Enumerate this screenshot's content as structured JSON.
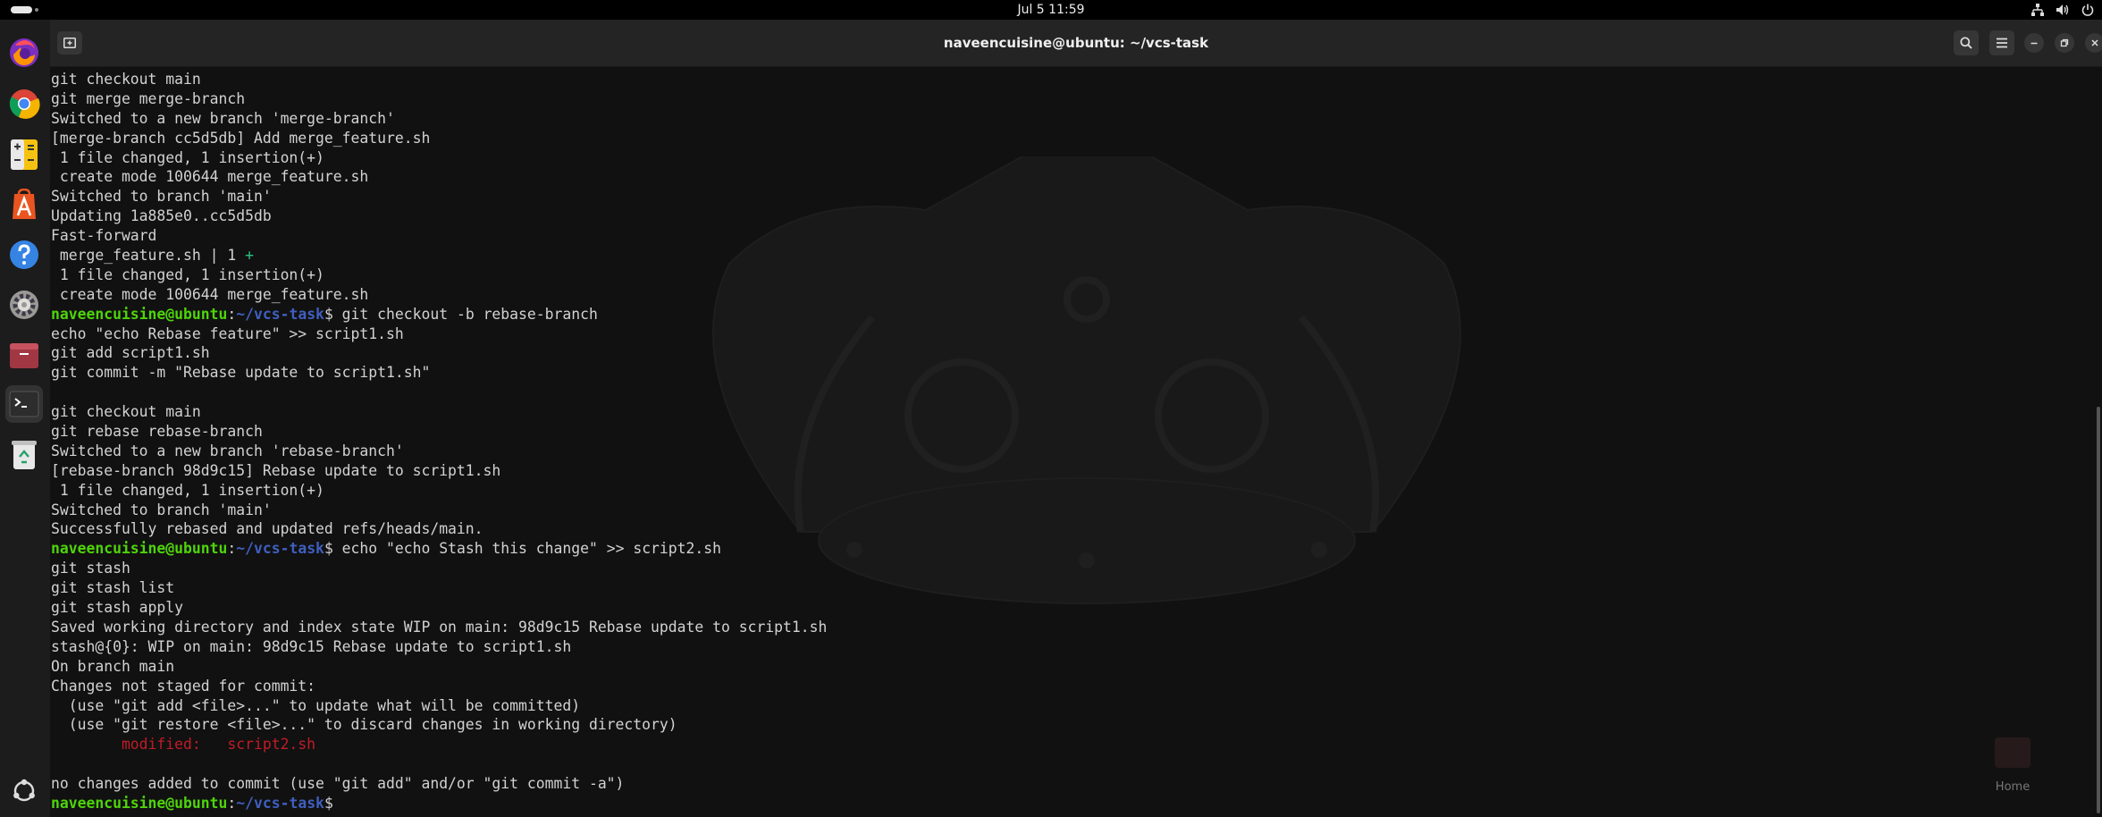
{
  "topbar": {
    "clock": "Jul 5  11:59",
    "tray_icons": [
      "network-icon",
      "volume-icon",
      "power-icon"
    ]
  },
  "dock": {
    "items": [
      "firefox-icon",
      "chrome-icon",
      "calculator-icon",
      "app-center-icon",
      "help-icon",
      "settings-icon",
      "files-icon",
      "terminal-icon",
      "trash-icon"
    ],
    "show_apps": "show-apps-icon"
  },
  "window": {
    "title": "naveencuisine@ubuntu: ~/vcs-task"
  },
  "prompt": {
    "user": "naveencuisine@ubuntu",
    "path": "~/vcs-task",
    "sep": ":",
    "dollar": "$"
  },
  "terminal": {
    "lines": [
      {
        "t": "text",
        "text": "git checkout main"
      },
      {
        "t": "text",
        "text": "git merge merge-branch"
      },
      {
        "t": "text",
        "text": "Switched to a new branch 'merge-branch'"
      },
      {
        "t": "text",
        "text": "[merge-branch cc5d5db] Add merge_feature.sh"
      },
      {
        "t": "text",
        "text": " 1 file changed, 1 insertion(+)"
      },
      {
        "t": "text",
        "text": " create mode 100644 merge_feature.sh"
      },
      {
        "t": "text",
        "text": "Switched to branch 'main'"
      },
      {
        "t": "text",
        "text": "Updating 1a885e0..cc5d5db"
      },
      {
        "t": "text",
        "text": "Fast-forward"
      },
      {
        "t": "diffstat",
        "text": " merge_feature.sh | 1 ",
        "plus": "+"
      },
      {
        "t": "text",
        "text": " 1 file changed, 1 insertion(+)"
      },
      {
        "t": "text",
        "text": " create mode 100644 merge_feature.sh"
      },
      {
        "t": "prompt",
        "cmd": " git checkout -b rebase-branch"
      },
      {
        "t": "text",
        "text": "echo \"echo Rebase feature\" >> script1.sh"
      },
      {
        "t": "text",
        "text": "git add script1.sh"
      },
      {
        "t": "text",
        "text": "git commit -m \"Rebase update to script1.sh\""
      },
      {
        "t": "text",
        "text": ""
      },
      {
        "t": "text",
        "text": "git checkout main"
      },
      {
        "t": "text",
        "text": "git rebase rebase-branch"
      },
      {
        "t": "text",
        "text": "Switched to a new branch 'rebase-branch'"
      },
      {
        "t": "text",
        "text": "[rebase-branch 98d9c15] Rebase update to script1.sh"
      },
      {
        "t": "text",
        "text": " 1 file changed, 1 insertion(+)"
      },
      {
        "t": "text",
        "text": "Switched to branch 'main'"
      },
      {
        "t": "text",
        "text": "Successfully rebased and updated refs/heads/main."
      },
      {
        "t": "prompt",
        "cmd": " echo \"echo Stash this change\" >> script2.sh"
      },
      {
        "t": "text",
        "text": "git stash"
      },
      {
        "t": "text",
        "text": "git stash list"
      },
      {
        "t": "text",
        "text": "git stash apply"
      },
      {
        "t": "text",
        "text": "Saved working directory and index state WIP on main: 98d9c15 Rebase update to script1.sh"
      },
      {
        "t": "text",
        "text": "stash@{0}: WIP on main: 98d9c15 Rebase update to script1.sh"
      },
      {
        "t": "text",
        "text": "On branch main"
      },
      {
        "t": "text",
        "text": "Changes not staged for commit:"
      },
      {
        "t": "text",
        "text": "  (use \"git add <file>...\" to update what will be committed)"
      },
      {
        "t": "text",
        "text": "  (use \"git restore <file>...\" to discard changes in working directory)"
      },
      {
        "t": "modified",
        "text": "\tmodified:   script2.sh"
      },
      {
        "t": "text",
        "text": ""
      },
      {
        "t": "text",
        "text": "no changes added to commit (use \"git add\" and/or \"git commit -a\")"
      },
      {
        "t": "prompt",
        "cmd": ""
      }
    ]
  },
  "desktop": {
    "home_label": "Home"
  }
}
